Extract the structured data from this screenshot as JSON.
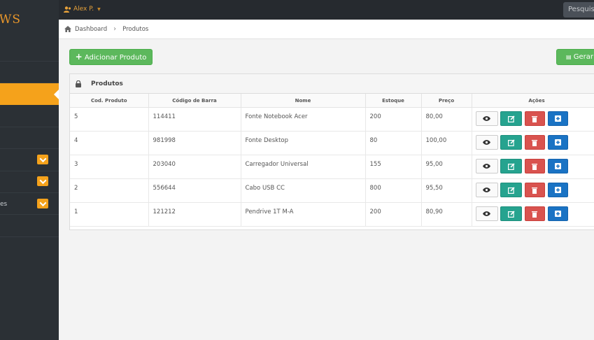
{
  "brand": {
    "logo_text": "OWS"
  },
  "topbar": {
    "user_name": "Alex P.",
    "search_placeholder": "Pesquisar"
  },
  "sidebar": {
    "partial_label": "es"
  },
  "breadcrumb": {
    "home": "Dashboard",
    "current": "Produtos"
  },
  "toolbar": {
    "add_label": "Adicionar Produto",
    "generate_label": "Gerar"
  },
  "panel": {
    "title": "Produtos"
  },
  "table": {
    "columns": [
      "Cod. Produto",
      "Código de Barra",
      "Nome",
      "Estoque",
      "Preço",
      "Ações"
    ],
    "rows": [
      {
        "cod": "5",
        "barcode": "114411",
        "nome": "Fonte Notebook Acer",
        "estoque": "200",
        "preco": "80,00"
      },
      {
        "cod": "4",
        "barcode": "981998",
        "nome": "Fonte Desktop",
        "estoque": "80",
        "preco": "100,00"
      },
      {
        "cod": "3",
        "barcode": "203040",
        "nome": "Carregador Universal",
        "estoque": "155",
        "preco": "95,00"
      },
      {
        "cod": "2",
        "barcode": "556644",
        "nome": "Cabo USB CC",
        "estoque": "800",
        "preco": "95,50"
      },
      {
        "cod": "1",
        "barcode": "121212",
        "nome": "Pendrive 1T M-A",
        "estoque": "200",
        "preco": "80,90"
      }
    ]
  },
  "colors": {
    "accent": "#f5a21b",
    "success": "#5cb85c",
    "teal": "#26a38f",
    "danger": "#d9534f",
    "primary": "#1a73c4"
  },
  "icons": {
    "user": "user-icon",
    "home": "home-icon",
    "lock": "lock-icon",
    "view": "eye-icon",
    "edit": "edit-icon",
    "delete": "trash-icon",
    "add": "plus-square-icon"
  }
}
